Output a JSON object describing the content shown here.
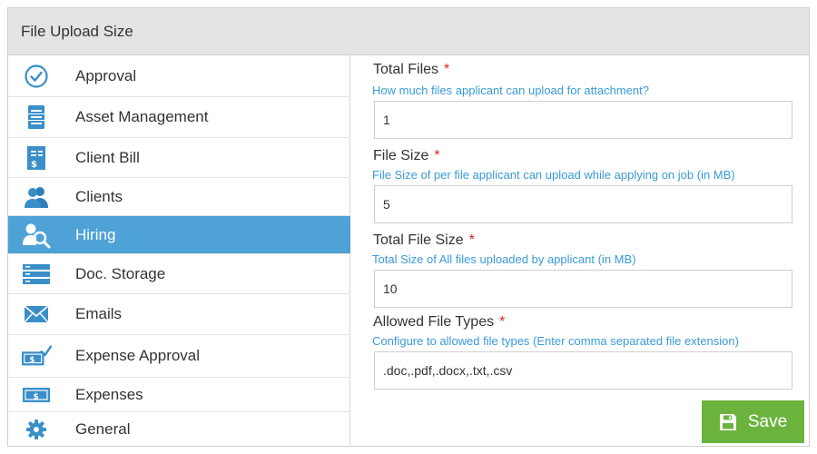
{
  "header": {
    "title": "File Upload Size"
  },
  "sidebar": {
    "items": [
      {
        "label": "Approval",
        "icon": "check-circle-icon"
      },
      {
        "label": "Asset Management",
        "icon": "cabinet-icon"
      },
      {
        "label": "Client Bill",
        "icon": "bill-icon"
      },
      {
        "label": "Clients",
        "icon": "users-icon"
      },
      {
        "label": "Hiring",
        "icon": "user-search-icon",
        "active": true
      },
      {
        "label": "Doc. Storage",
        "icon": "storage-icon"
      },
      {
        "label": "Emails",
        "icon": "envelope-icon"
      },
      {
        "label": "Expense Approval",
        "icon": "money-check-icon"
      },
      {
        "label": "Expenses",
        "icon": "money-icon"
      },
      {
        "label": "General",
        "icon": "gear-icon"
      }
    ]
  },
  "form": {
    "total_files": {
      "label": "Total Files",
      "required": "*",
      "help": "How much files applicant can upload for attachment?",
      "value": "1"
    },
    "file_size": {
      "label": "File Size",
      "required": "*",
      "help": "File Size of per file applicant can upload while applying on job (in MB)",
      "value": "5"
    },
    "total_file_size": {
      "label": "Total File Size",
      "required": "*",
      "help": "Total Size of All files uploaded by applicant (in MB)",
      "value": "10"
    },
    "allowed_file_types": {
      "label": "Allowed File Types",
      "required": "*",
      "help": "Configure to allowed file types (Enter comma separated file extension)",
      "value": ".doc,.pdf,.docx,.txt,.csv"
    }
  },
  "save_button": {
    "label": "Save",
    "icon": "floppy-disk-icon"
  },
  "colors": {
    "accent": "#4ea2d6",
    "help_text": "#3a9ad9",
    "required": "#e02020",
    "save": "#6cb33e",
    "header_bg": "#e4e4e4"
  }
}
